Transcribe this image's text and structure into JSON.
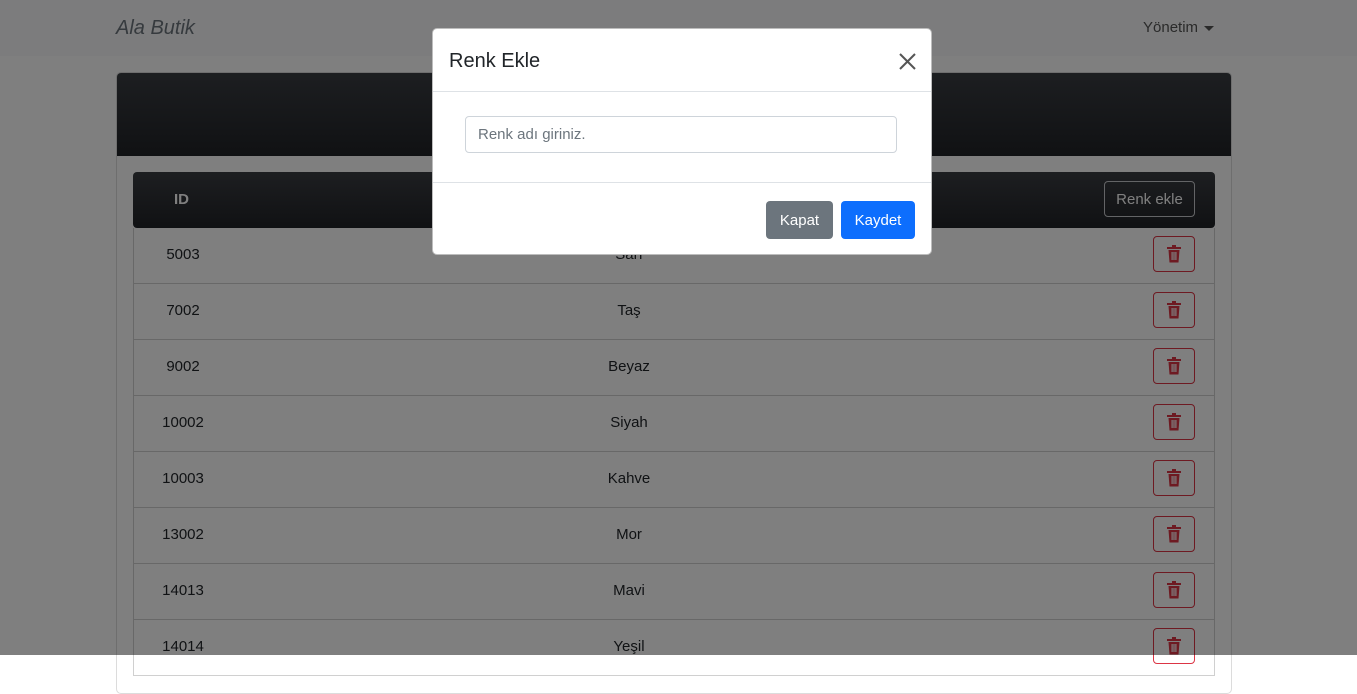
{
  "navbar": {
    "brand": "Ala Butik",
    "menu_label": "Yönetim"
  },
  "table": {
    "id_header": "ID",
    "add_button_label": "Renk ekle",
    "rows": [
      {
        "id": "5003",
        "name": "Sarı"
      },
      {
        "id": "7002",
        "name": "Taş"
      },
      {
        "id": "9002",
        "name": "Beyaz"
      },
      {
        "id": "10002",
        "name": "Siyah"
      },
      {
        "id": "10003",
        "name": "Kahve"
      },
      {
        "id": "13002",
        "name": "Mor"
      },
      {
        "id": "14013",
        "name": "Mavi"
      },
      {
        "id": "14014",
        "name": "Yeşil"
      }
    ]
  },
  "modal": {
    "title": "Renk Ekle",
    "input_placeholder": "Renk adı giriniz.",
    "input_value": "",
    "close_label": "Kapat",
    "save_label": "Kaydet"
  },
  "colors": {
    "primary": "#0d6efd",
    "secondary": "#6c757d",
    "danger": "#dc3545",
    "header_dark": "#212327"
  }
}
